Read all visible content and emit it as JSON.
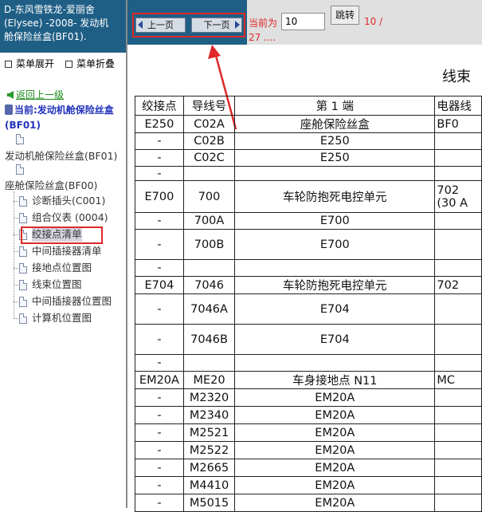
{
  "left_panel": {
    "header_line1": "D-东风雪铁龙-爱丽舍",
    "header_line2": "(Elysee)   -2008- 发动机",
    "header_line3": "舱保险丝盒(BF01).",
    "expand_label": "菜单展开",
    "collapse_label": "菜单折叠",
    "back_label": "返回上一级",
    "current_label": "当前:发动机舱保险丝盒(BF01)",
    "tree": {
      "section1": "发动机舱保险丝盒(BF01)",
      "section2": "座舱保险丝盒(BF00)",
      "items": [
        "诊断插头(C001)",
        "组合仪表 (0004)",
        "绞接点清单",
        "中间插接器清单",
        "接地点位置图",
        "线束位置图",
        "中间插接器位置图",
        "计算机位置图"
      ]
    }
  },
  "topnav": {
    "prev_label": "上一页",
    "next_label": "下一页",
    "page_prefix": "当前为",
    "page_value": "10",
    "jump_label": "跳转",
    "page_total_a": "10 /",
    "page_total_b": "27 ...."
  },
  "content": {
    "title": "线束",
    "table": {
      "headers": [
        "绞接点",
        "导线号",
        "第 1 端",
        "电器线"
      ],
      "rows": [
        [
          "E250",
          "C02A",
          "座舱保险丝盒",
          "BF0"
        ],
        [
          "-",
          "C02B",
          "E250",
          ""
        ],
        [
          "-",
          "C02C",
          "E250",
          ""
        ],
        [
          "-",
          "",
          "",
          ""
        ],
        [
          "E700",
          "700",
          "车轮防抱死电控单元",
          "702\n(30 A"
        ],
        [
          "-",
          "700A",
          "E700",
          ""
        ],
        [
          "-",
          "700B",
          "E700",
          ""
        ],
        [
          "-",
          "",
          "",
          ""
        ],
        [
          "E704",
          "7046",
          "车轮防抱死电控单元",
          "702"
        ],
        [
          "-",
          "7046A",
          "E704",
          ""
        ],
        [
          "-",
          "7046B",
          "E704",
          ""
        ],
        [
          "-",
          "",
          "",
          ""
        ],
        [
          "EM20A",
          "ME20",
          "车身接地点  N11",
          "MC"
        ],
        [
          "-",
          "M2320",
          "EM20A",
          ""
        ],
        [
          "-",
          "M2340",
          "EM20A",
          ""
        ],
        [
          "-",
          "M2521",
          "EM20A",
          ""
        ],
        [
          "-",
          "M2522",
          "EM20A",
          ""
        ],
        [
          "-",
          "M2665",
          "EM20A",
          ""
        ],
        [
          "-",
          "M4410",
          "EM20A",
          ""
        ],
        [
          "-",
          "M5015",
          "EM20A",
          ""
        ]
      ]
    }
  },
  "colors": {
    "header_blue": "#1f5f86",
    "highlight_red": "#e02828",
    "link_green": "#1a8a1a",
    "current_blue": "#2233bb"
  }
}
